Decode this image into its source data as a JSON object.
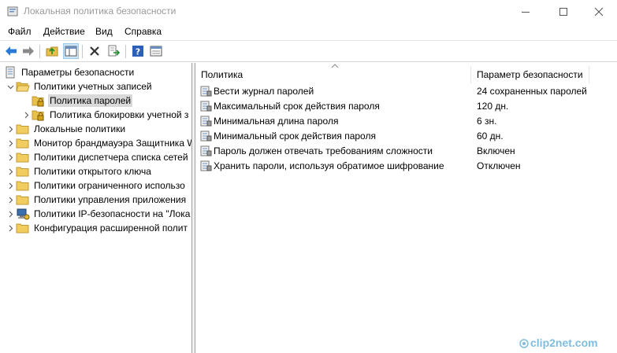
{
  "window": {
    "title": "Локальная политика безопасности",
    "icon": "security-policy-icon"
  },
  "menu": [
    "Файл",
    "Действие",
    "Вид",
    "Справка"
  ],
  "toolbar": {
    "buttons": [
      "back-arrow-icon",
      "forward-arrow-icon",
      "up-folder-icon",
      "show-hide-tree-icon",
      "delete-icon",
      "export-list-icon",
      "help-icon",
      "properties-icon"
    ]
  },
  "tree": {
    "root": "Параметры безопасности",
    "nodes": [
      {
        "label": "Политики учетных записей",
        "expanded": true
      },
      {
        "label": "Политика паролей",
        "selected": true
      },
      {
        "label": "Политика блокировки учетной з"
      },
      {
        "label": "Локальные политики"
      },
      {
        "label": "Монитор брандмауэра Защитника W"
      },
      {
        "label": "Политики диспетчера списка сетей"
      },
      {
        "label": "Политики открытого ключа"
      },
      {
        "label": "Политики ограниченного использо"
      },
      {
        "label": "Политики управления приложения"
      },
      {
        "label": "Политики IP-безопасности на \"Лока"
      },
      {
        "label": "Конфигурация расширенной полит"
      }
    ]
  },
  "list": {
    "columns": [
      "Политика",
      "Параметр безопасности"
    ],
    "rows": [
      {
        "policy": "Вести журнал паролей",
        "value": "24 сохраненных паролей"
      },
      {
        "policy": "Максимальный срок действия пароля",
        "value": "120 дн."
      },
      {
        "policy": "Минимальная длина пароля",
        "value": "6 зн."
      },
      {
        "policy": "Минимальный срок действия пароля",
        "value": "60 дн."
      },
      {
        "policy": "Пароль должен отвечать требованиям сложности",
        "value": "Включен"
      },
      {
        "policy": "Хранить пароли, используя обратимое шифрование",
        "value": "Отключен"
      }
    ]
  },
  "watermark": "clip2net.com"
}
